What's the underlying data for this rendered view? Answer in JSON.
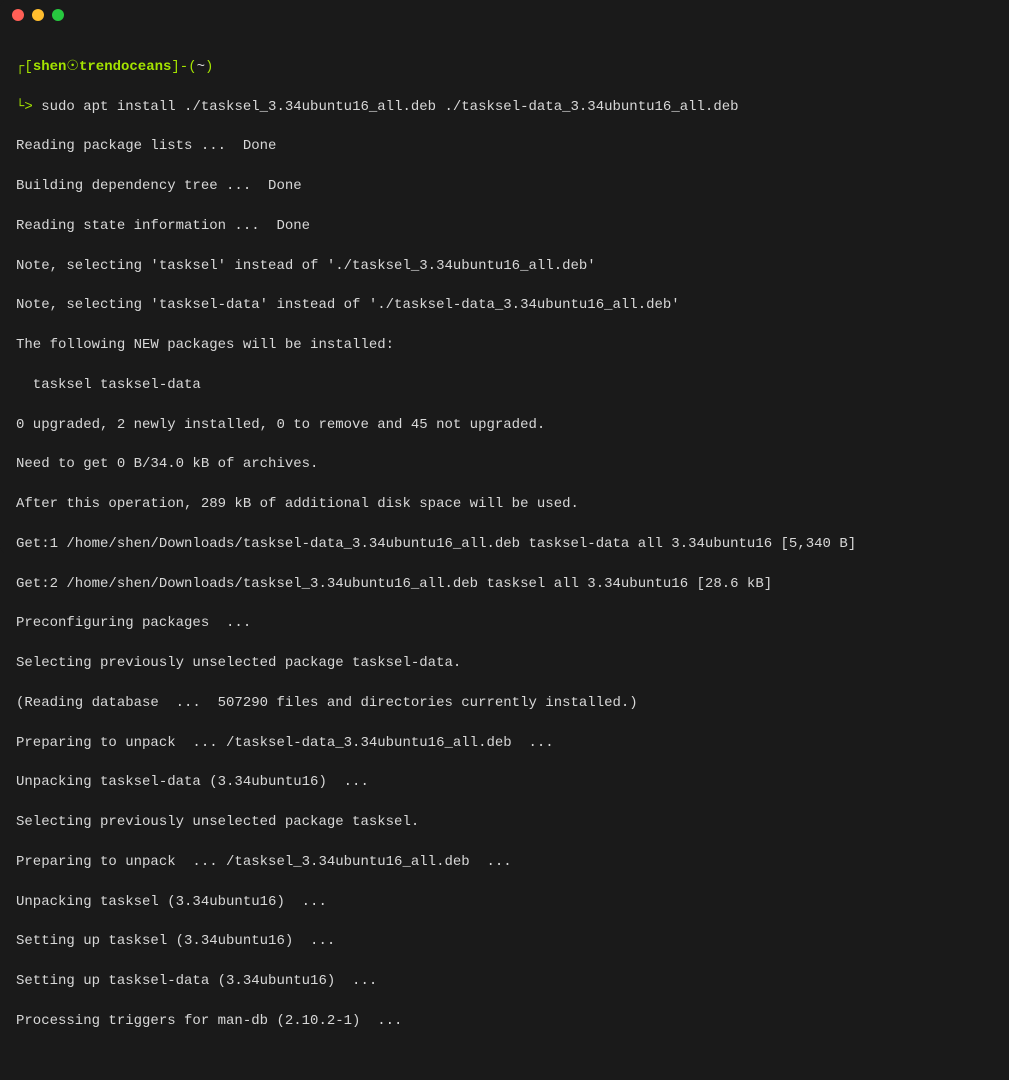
{
  "titlebar": {
    "close": "close",
    "minimize": "minimize",
    "maximize": "maximize"
  },
  "prompt": {
    "open_bracket": "┌[",
    "user": "shen",
    "at": "☉",
    "host": "trendoceans",
    "close_bracket": "]-",
    "path_open": "(",
    "path": "~",
    "path_close": ")",
    "arrow": "└>"
  },
  "command": " sudo apt install ./tasksel_3.34ubuntu16_all.deb ./tasksel-data_3.34ubuntu16_all.deb",
  "output": [
    "Reading package lists ...  Done",
    "Building dependency tree ...  Done",
    "Reading state information ...  Done",
    "Note, selecting 'tasksel' instead of './tasksel_3.34ubuntu16_all.deb'",
    "Note, selecting 'tasksel-data' instead of './tasksel-data_3.34ubuntu16_all.deb'",
    "The following NEW packages will be installed:",
    "  tasksel tasksel-data",
    "0 upgraded, 2 newly installed, 0 to remove and 45 not upgraded.",
    "Need to get 0 B/34.0 kB of archives.",
    "After this operation, 289 kB of additional disk space will be used.",
    "Get:1 /home/shen/Downloads/tasksel-data_3.34ubuntu16_all.deb tasksel-data all 3.34ubuntu16 [5,340 B]",
    "Get:2 /home/shen/Downloads/tasksel_3.34ubuntu16_all.deb tasksel all 3.34ubuntu16 [28.6 kB]",
    "Preconfiguring packages  ...",
    "Selecting previously unselected package tasksel-data.",
    "(Reading database  ...  507290 files and directories currently installed.)",
    "Preparing to unpack  ... /tasksel-data_3.34ubuntu16_all.deb  ...",
    "Unpacking tasksel-data (3.34ubuntu16)  ...",
    "Selecting previously unselected package tasksel.",
    "Preparing to unpack  ... /tasksel_3.34ubuntu16_all.deb  ...",
    "Unpacking tasksel (3.34ubuntu16)  ...",
    "Setting up tasksel (3.34ubuntu16)  ...",
    "Setting up tasksel-data (3.34ubuntu16)  ...",
    "Processing triggers for man-db (2.10.2-1)  ..."
  ]
}
